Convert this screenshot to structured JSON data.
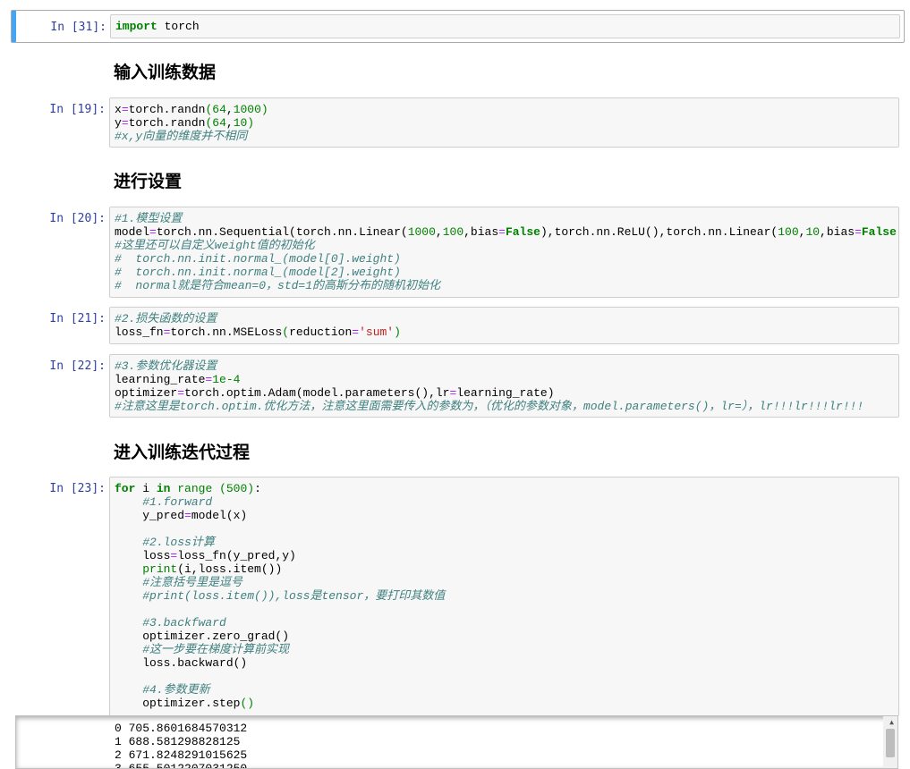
{
  "cells": {
    "c31": {
      "prompt": "In [31]:"
    },
    "c19": {
      "prompt": "In [19]:"
    },
    "c20": {
      "prompt": "In [20]:"
    },
    "c21": {
      "prompt": "In [21]:"
    },
    "c22": {
      "prompt": "In [22]:"
    },
    "c23": {
      "prompt": "In [23]:"
    }
  },
  "markdown": {
    "h1": "输入训练数据",
    "h2": "进行设置",
    "h3": "进入训练迭代过程"
  },
  "output_lines": [
    "0 705.8601684570312",
    "1 688.581298828125",
    "2 671.8248291015625",
    "3 655.5012207031250"
  ],
  "colors": {
    "prompt": "#303f9f",
    "selected_bar": "#42a5f5",
    "comment": "#408080",
    "keyword": "#008000"
  }
}
